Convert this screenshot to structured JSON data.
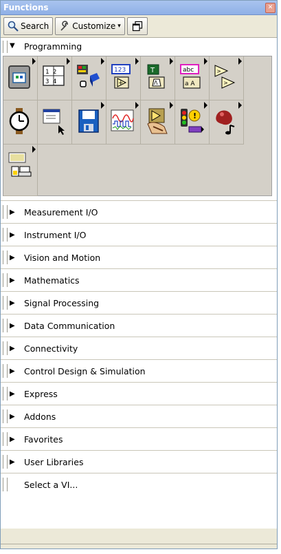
{
  "window": {
    "title": "Functions"
  },
  "toolbar": {
    "search_label": "Search",
    "customize_label": "Customize",
    "customize_caret": "▾"
  },
  "programming": {
    "label": "Programming",
    "expanded": true,
    "icons": [
      "structures-icon",
      "array-icon",
      "cluster-class-variant-icon",
      "numeric-icon",
      "boolean-icon",
      "string-icon",
      "comparison-icon",
      "timing-icon",
      "dialog-user-interface-icon",
      "file-io-icon",
      "waveform-icon",
      "application-control-icon",
      "synchronization-icon",
      "graphics-sound-icon",
      "report-generation-icon"
    ]
  },
  "categories": [
    {
      "label": "Measurement I/O"
    },
    {
      "label": "Instrument I/O"
    },
    {
      "label": "Vision and Motion"
    },
    {
      "label": "Mathematics"
    },
    {
      "label": "Signal Processing"
    },
    {
      "label": "Data Communication"
    },
    {
      "label": "Connectivity"
    },
    {
      "label": "Control Design & Simulation"
    },
    {
      "label": "Express"
    },
    {
      "label": "Addons"
    },
    {
      "label": "Favorites"
    },
    {
      "label": "User Libraries"
    }
  ],
  "select_vi": {
    "label": "Select a VI..."
  },
  "colors": {
    "title_bar": "#a9c4ef",
    "palette_bg": "#ece9d8",
    "icon_grid_bg": "#d4d0c8"
  }
}
